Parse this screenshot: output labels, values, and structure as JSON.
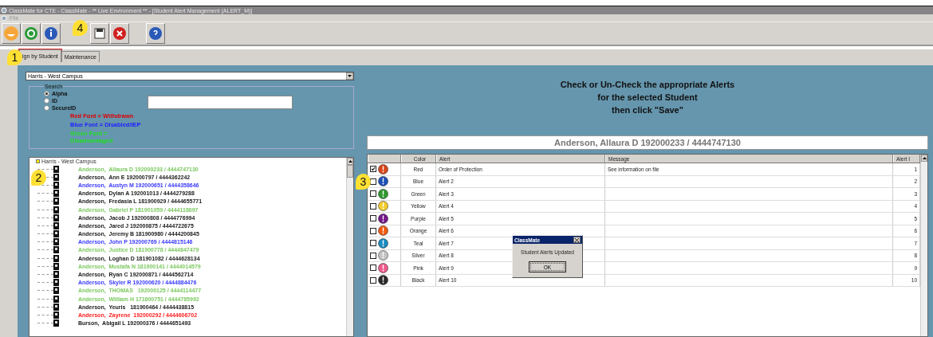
{
  "window": {
    "title": "ClassMate for CTE - ClassMate - ** Live Environment ** - [Student Alert Management (ALERT_M)]"
  },
  "menu": [
    "File"
  ],
  "tabs": [
    {
      "label": "ign by Student",
      "selected": true
    },
    {
      "label": "Maintenance",
      "selected": false
    }
  ],
  "campus_dropdown": {
    "value": "Harris - West Campus"
  },
  "search": {
    "label": "Search",
    "options": [
      {
        "label": "Alpha",
        "selected": true
      },
      {
        "label": "ID",
        "selected": false
      },
      {
        "label": "SecureID",
        "selected": false
      }
    ]
  },
  "legend": [
    {
      "text": "Red Font = Withdrawn",
      "color": "#e00000"
    },
    {
      "text": "Blue Font = Disabled/IEP",
      "color": "#2020ff"
    },
    {
      "text": "Green Font = Disadvantaged",
      "color": "#22e022"
    }
  ],
  "tree": {
    "label": "Harris - West Campus",
    "expanded": true,
    "children": [
      {
        "label": "Anderson,  Allaura D 192000233 / 4444747130",
        "color": "#7cc860"
      },
      {
        "label": "Anderson,  Ann E 192000797 / 4444362242",
        "color": "#202020"
      },
      {
        "label": "Anderson,  Austyn M 192000651 / 4444358646",
        "color": "#3a3aff"
      },
      {
        "label": "Anderson,  Dylan A 192001013 / 4444279288",
        "color": "#202020"
      },
      {
        "label": "Anderson,  Fredasia L 181900929 / 4444655771",
        "color": "#202020"
      },
      {
        "label": "Anderson,  Gabriel P 181901059 / 4444118697",
        "color": "#7cc860"
      },
      {
        "label": "Anderson,  Jacob J 192000808 / 4444776994",
        "color": "#202020"
      },
      {
        "label": "Anderson,  Jared J 192000875 / 4444722675",
        "color": "#202020"
      },
      {
        "label": "Anderson,  Jeremy B 181900980 / 4444200845",
        "color": "#202020"
      },
      {
        "label": "Anderson,  John P 192000769 / 4444815146",
        "color": "#3a3aff"
      },
      {
        "label": "Anderson,  Justice D 181900778 / 4444847479",
        "color": "#7cc860"
      },
      {
        "label": "Anderson,  Loghan D 181901082 / 4444628134",
        "color": "#202020"
      },
      {
        "label": "Anderson,  Mustafa N 181900141 / 4444014579",
        "color": "#7cc860"
      },
      {
        "label": "Anderson,  Ryan C 192000871 / 4444562714",
        "color": "#202020"
      },
      {
        "label": "Anderson,  Skyler R 192000620 / 4444884476",
        "color": "#3a3aff"
      },
      {
        "label": "Anderson,  THOMAS   192000125 / 4444114477",
        "color": "#7cc860"
      },
      {
        "label": "Anderson,  William H 171800751 / 4444785992",
        "color": "#7cc860"
      },
      {
        "label": "Anderson,  Yeuris   181900464 / 4444438815",
        "color": "#202020"
      },
      {
        "label": "Anderson,  Zayrene  192000292 / 4444606702",
        "color": "#ff2020"
      },
      {
        "label": "Burson,  Abigail L 192000376 / 4444651493",
        "color": "#202020"
      }
    ]
  },
  "instructions": [
    "Check or Un-Check the appropriate Alerts",
    "for the selected Student",
    "then click \"Save\""
  ],
  "selected_student": "Anderson,  Allaura D 192000233 / 4444747130",
  "alerts": {
    "columns": [
      "Color",
      "Alert",
      "Message",
      "Alert I"
    ],
    "rows": [
      {
        "checked": true,
        "color": "#d9451a",
        "color_name": "Red",
        "alert": "Order of Protection",
        "message": "See information on file",
        "id": "1"
      },
      {
        "checked": false,
        "color": "#1f4fb8",
        "color_name": "Blue",
        "alert": "Alert 2",
        "id": "2"
      },
      {
        "checked": false,
        "color": "#2e9a2e",
        "color_name": "Green",
        "alert": "Alert 3",
        "id": "3"
      },
      {
        "checked": false,
        "color": "#f2cc30",
        "color_name": "Yellow",
        "alert": "Alert 4",
        "id": "4"
      },
      {
        "checked": false,
        "color": "#74178a",
        "color_name": "Purple",
        "alert": "Alert 5",
        "id": "5"
      },
      {
        "checked": false,
        "color": "#f25a10",
        "color_name": "Orange",
        "alert": "Alert 6",
        "id": "6"
      },
      {
        "checked": false,
        "color": "#1a8cc0",
        "color_name": "Teal",
        "alert": "Alert 7",
        "id": "7"
      },
      {
        "checked": false,
        "color": "#c4c4c4",
        "color_name": "Silver",
        "alert": "Alert 8",
        "id": "8"
      },
      {
        "checked": false,
        "color": "#ee5a8c",
        "color_name": "Pink",
        "alert": "Alert 9",
        "id": "9"
      },
      {
        "checked": false,
        "color": "#2a2a2a",
        "color_name": "Black",
        "alert": "Alert 10",
        "id": "10"
      }
    ]
  },
  "dialog": {
    "title": "ClassMate",
    "message": "Student Alerts Updated",
    "button": "OK"
  },
  "callouts": [
    "1",
    "2",
    "3",
    "4"
  ]
}
